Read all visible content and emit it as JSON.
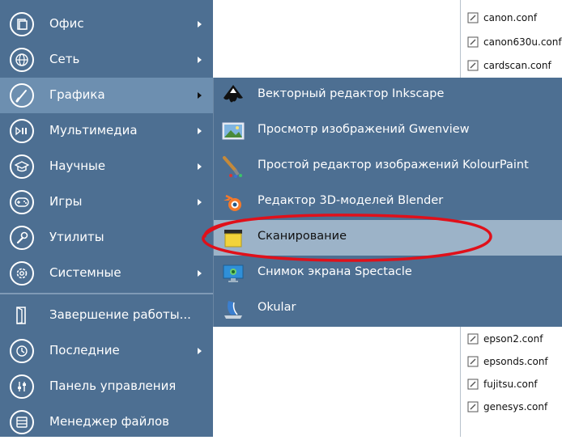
{
  "main_menu": {
    "items": [
      {
        "label": "Офис",
        "icon": "office-icon",
        "has_submenu": true
      },
      {
        "label": "Сеть",
        "icon": "globe-icon",
        "has_submenu": true
      },
      {
        "label": "Графика",
        "icon": "brush-icon",
        "has_submenu": true,
        "active": true
      },
      {
        "label": "Мультимедиа",
        "icon": "media-icon",
        "has_submenu": true
      },
      {
        "label": "Научные",
        "icon": "graduation-cap-icon",
        "has_submenu": true
      },
      {
        "label": "Игры",
        "icon": "gamepad-icon",
        "has_submenu": true
      },
      {
        "label": "Утилиты",
        "icon": "wrench-icon",
        "has_submenu": false
      },
      {
        "label": "Системные",
        "icon": "gear-icon",
        "has_submenu": true
      },
      {
        "label": "Завершение работы...",
        "icon": "exit-door-icon",
        "has_submenu": false
      },
      {
        "label": "Последние",
        "icon": "history-icon",
        "has_submenu": true
      },
      {
        "label": "Панель управления",
        "icon": "control-panel-icon",
        "has_submenu": false
      },
      {
        "label": "Менеджер файлов",
        "icon": "file-manager-icon",
        "has_submenu": false
      }
    ]
  },
  "graphics_submenu": {
    "items": [
      {
        "label": "Векторный редактор Inkscape",
        "icon": "inkscape-icon"
      },
      {
        "label": "Просмотр изображений Gwenview",
        "icon": "gwenview-icon"
      },
      {
        "label": "Простой редактор изображений KolourPaint",
        "icon": "kolourpaint-icon"
      },
      {
        "label": "Редактор 3D-моделей Blender",
        "icon": "blender-icon"
      },
      {
        "label": "Сканирование",
        "icon": "scanner-icon",
        "hovered": true
      },
      {
        "label": "Снимок экрана Spectacle",
        "icon": "spectacle-icon"
      },
      {
        "label": "Okular",
        "icon": "okular-icon"
      }
    ]
  },
  "file_list": {
    "items_top": [
      "canon.conf",
      "canon630u.conf",
      "cardscan.conf"
    ],
    "items_bottom": [
      "epson2.conf",
      "epsonds.conf",
      "fujitsu.conf",
      "genesys.conf"
    ]
  },
  "colors": {
    "menu_bg": "#4d6f92",
    "active_bg": "#6d8fb0",
    "hover_bg": "#9cb3c8",
    "annotation": "#e0101a"
  }
}
